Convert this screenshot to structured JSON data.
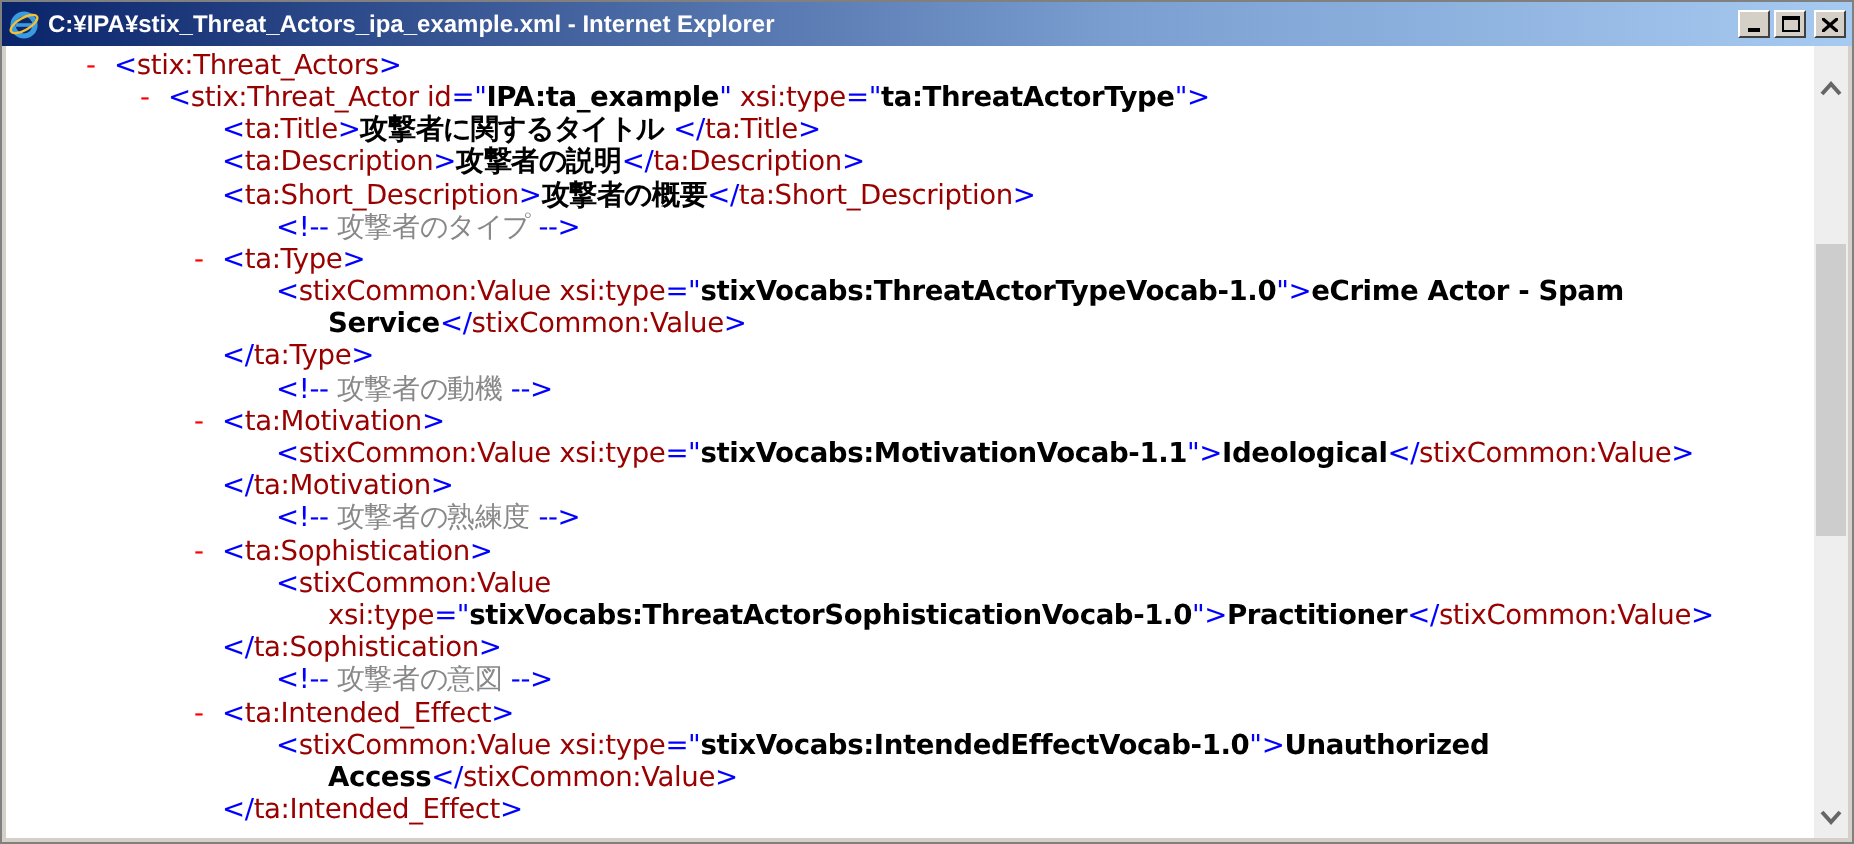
{
  "window": {
    "title": "C:¥IPA¥stix_Threat_Actors_ipa_example.xml - Internet Explorer"
  },
  "document": {
    "kind": "element",
    "toggle": "-",
    "open": [
      {
        "kind": "markup",
        "text": "<"
      },
      {
        "kind": "name",
        "text": "stix:Threat_Actors"
      },
      {
        "kind": "markup",
        "text": ">"
      }
    ],
    "children": [
      {
        "kind": "element",
        "toggle": "-",
        "open": [
          {
            "kind": "markup",
            "text": "<"
          },
          {
            "kind": "name",
            "text": "stix:Threat_Actor id"
          },
          {
            "kind": "markup",
            "text": "=\""
          },
          {
            "kind": "value",
            "text": "IPA:ta_example"
          },
          {
            "kind": "markup",
            "text": "\""
          },
          {
            "kind": "name",
            "text": " xsi:type"
          },
          {
            "kind": "markup",
            "text": "=\""
          },
          {
            "kind": "value",
            "text": "ta:ThreatActorType"
          },
          {
            "kind": "markup",
            "text": "\">"
          }
        ],
        "children": [
          {
            "kind": "leaf",
            "lines": [
              [
                {
                  "kind": "markup",
                  "text": "<"
                },
                {
                  "kind": "name",
                  "text": "ta:Title"
                },
                {
                  "kind": "markup",
                  "text": ">"
                },
                {
                  "kind": "value",
                  "text": "攻撃者に関するタイトル "
                },
                {
                  "kind": "markup",
                  "text": "</"
                },
                {
                  "kind": "name",
                  "text": "ta:Title"
                },
                {
                  "kind": "markup",
                  "text": ">"
                }
              ]
            ]
          },
          {
            "kind": "leaf",
            "lines": [
              [
                {
                  "kind": "markup",
                  "text": "<"
                },
                {
                  "kind": "name",
                  "text": "ta:Description"
                },
                {
                  "kind": "markup",
                  "text": ">"
                },
                {
                  "kind": "value",
                  "text": "攻撃者の説明"
                },
                {
                  "kind": "markup",
                  "text": "</"
                },
                {
                  "kind": "name",
                  "text": "ta:Description"
                },
                {
                  "kind": "markup",
                  "text": ">"
                }
              ]
            ]
          },
          {
            "kind": "leaf",
            "lines": [
              [
                {
                  "kind": "markup",
                  "text": "<"
                },
                {
                  "kind": "name",
                  "text": "ta:Short_Description"
                },
                {
                  "kind": "markup",
                  "text": ">"
                },
                {
                  "kind": "value",
                  "text": "攻撃者の概要"
                },
                {
                  "kind": "markup",
                  "text": "</"
                },
                {
                  "kind": "name",
                  "text": "ta:Short_Description"
                },
                {
                  "kind": "markup",
                  "text": ">"
                }
              ]
            ]
          },
          {
            "kind": "comment",
            "segs": [
              {
                "kind": "markup",
                "text": "<!--"
              },
              {
                "kind": "comment",
                "text": " 攻撃者のタイプ "
              },
              {
                "kind": "markup",
                "text": "-->"
              }
            ]
          },
          {
            "kind": "element",
            "toggle": "-",
            "open": [
              {
                "kind": "markup",
                "text": "<"
              },
              {
                "kind": "name",
                "text": "ta:Type"
              },
              {
                "kind": "markup",
                "text": ">"
              }
            ],
            "children": [
              {
                "kind": "leaf",
                "lines": [
                  [
                    {
                      "kind": "markup",
                      "text": "<"
                    },
                    {
                      "kind": "name",
                      "text": "stixCommon:Value xsi:type"
                    },
                    {
                      "kind": "markup",
                      "text": "=\""
                    },
                    {
                      "kind": "value",
                      "text": "stixVocabs:ThreatActorTypeVocab-1.0"
                    },
                    {
                      "kind": "markup",
                      "text": "\">"
                    },
                    {
                      "kind": "value",
                      "text": "eCrime Actor - Spam"
                    }
                  ],
                  [
                    {
                      "kind": "value",
                      "text": "Service"
                    },
                    {
                      "kind": "markup",
                      "text": "</"
                    },
                    {
                      "kind": "name",
                      "text": "stixCommon:Value"
                    },
                    {
                      "kind": "markup",
                      "text": ">"
                    }
                  ]
                ]
              }
            ],
            "close": [
              {
                "kind": "markup",
                "text": "</"
              },
              {
                "kind": "name",
                "text": "ta:Type"
              },
              {
                "kind": "markup",
                "text": ">"
              }
            ]
          },
          {
            "kind": "comment",
            "segs": [
              {
                "kind": "markup",
                "text": "<!--"
              },
              {
                "kind": "comment",
                "text": " 攻撃者の動機 "
              },
              {
                "kind": "markup",
                "text": "-->"
              }
            ]
          },
          {
            "kind": "element",
            "toggle": "-",
            "open": [
              {
                "kind": "markup",
                "text": "<"
              },
              {
                "kind": "name",
                "text": "ta:Motivation"
              },
              {
                "kind": "markup",
                "text": ">"
              }
            ],
            "children": [
              {
                "kind": "leaf",
                "lines": [
                  [
                    {
                      "kind": "markup",
                      "text": "<"
                    },
                    {
                      "kind": "name",
                      "text": "stixCommon:Value xsi:type"
                    },
                    {
                      "kind": "markup",
                      "text": "=\""
                    },
                    {
                      "kind": "value",
                      "text": "stixVocabs:MotivationVocab-1.1"
                    },
                    {
                      "kind": "markup",
                      "text": "\">"
                    },
                    {
                      "kind": "value",
                      "text": "Ideological"
                    },
                    {
                      "kind": "markup",
                      "text": "</"
                    },
                    {
                      "kind": "name",
                      "text": "stixCommon:Value"
                    },
                    {
                      "kind": "markup",
                      "text": ">"
                    }
                  ]
                ]
              }
            ],
            "close": [
              {
                "kind": "markup",
                "text": "</"
              },
              {
                "kind": "name",
                "text": "ta:Motivation"
              },
              {
                "kind": "markup",
                "text": ">"
              }
            ]
          },
          {
            "kind": "comment",
            "segs": [
              {
                "kind": "markup",
                "text": "<!--"
              },
              {
                "kind": "comment",
                "text": " 攻撃者の熟練度 "
              },
              {
                "kind": "markup",
                "text": "-->"
              }
            ]
          },
          {
            "kind": "element",
            "toggle": "-",
            "open": [
              {
                "kind": "markup",
                "text": "<"
              },
              {
                "kind": "name",
                "text": "ta:Sophistication"
              },
              {
                "kind": "markup",
                "text": ">"
              }
            ],
            "children": [
              {
                "kind": "leaf",
                "lines": [
                  [
                    {
                      "kind": "markup",
                      "text": "<"
                    },
                    {
                      "kind": "name",
                      "text": "stixCommon:Value"
                    }
                  ],
                  [
                    {
                      "kind": "name",
                      "text": "xsi:type"
                    },
                    {
                      "kind": "markup",
                      "text": "=\""
                    },
                    {
                      "kind": "value",
                      "text": "stixVocabs:ThreatActorSophisticationVocab-1.0"
                    },
                    {
                      "kind": "markup",
                      "text": "\">"
                    },
                    {
                      "kind": "value",
                      "text": "Practitioner"
                    },
                    {
                      "kind": "markup",
                      "text": "</"
                    },
                    {
                      "kind": "name",
                      "text": "stixCommon:Value"
                    },
                    {
                      "kind": "markup",
                      "text": ">"
                    }
                  ]
                ]
              }
            ],
            "close": [
              {
                "kind": "markup",
                "text": "</"
              },
              {
                "kind": "name",
                "text": "ta:Sophistication"
              },
              {
                "kind": "markup",
                "text": ">"
              }
            ]
          },
          {
            "kind": "comment",
            "segs": [
              {
                "kind": "markup",
                "text": "<!--"
              },
              {
                "kind": "comment",
                "text": " 攻撃者の意図 "
              },
              {
                "kind": "markup",
                "text": "-->"
              }
            ]
          },
          {
            "kind": "element",
            "toggle": "-",
            "open": [
              {
                "kind": "markup",
                "text": "<"
              },
              {
                "kind": "name",
                "text": "ta:Intended_Effect"
              },
              {
                "kind": "markup",
                "text": ">"
              }
            ],
            "children": [
              {
                "kind": "leaf",
                "lines": [
                  [
                    {
                      "kind": "markup",
                      "text": "<"
                    },
                    {
                      "kind": "name",
                      "text": "stixCommon:Value xsi:type"
                    },
                    {
                      "kind": "markup",
                      "text": "=\""
                    },
                    {
                      "kind": "value",
                      "text": "stixVocabs:IntendedEffectVocab-1.0"
                    },
                    {
                      "kind": "markup",
                      "text": "\">"
                    },
                    {
                      "kind": "value",
                      "text": "Unauthorized"
                    }
                  ],
                  [
                    {
                      "kind": "value",
                      "text": "Access"
                    },
                    {
                      "kind": "markup",
                      "text": "</"
                    },
                    {
                      "kind": "name",
                      "text": "stixCommon:Value"
                    },
                    {
                      "kind": "markup",
                      "text": ">"
                    }
                  ]
                ]
              }
            ],
            "close": [
              {
                "kind": "markup",
                "text": "</"
              },
              {
                "kind": "name",
                "text": "ta:Intended_Effect"
              },
              {
                "kind": "markup",
                "text": ">"
              }
            ]
          }
        ]
      }
    ]
  }
}
